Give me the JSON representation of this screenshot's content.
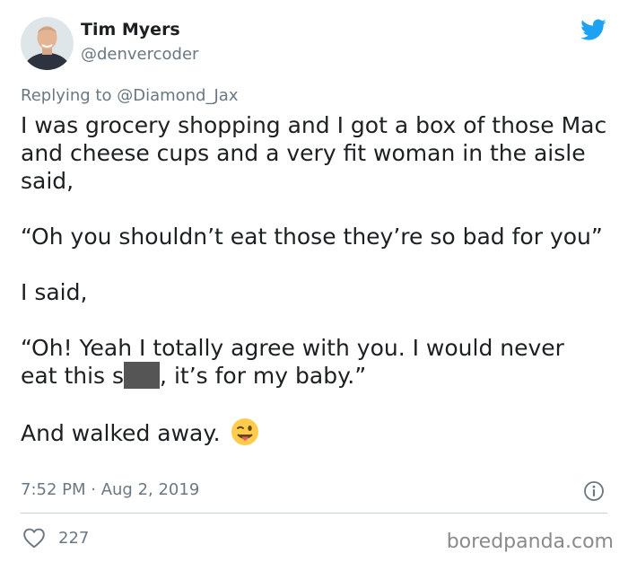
{
  "author": {
    "name": "Tim Myers",
    "handle": "@denvercoder"
  },
  "reply": {
    "prefix": "Replying to ",
    "target": "@Diamond_Jax"
  },
  "tweet": {
    "p1": "I was grocery shopping and I got a box of those Mac and cheese cups and a very fit woman in the aisle said,",
    "p2": " “Oh you shouldn’t eat those they’re so bad for you”",
    "p3": "I said,",
    "p4_line1": "“Oh! Yeah I totally agree with you. I would never",
    "p4_pre": "eat this s",
    "p4_post": ", it’s for my baby.”",
    "p5": "And walked away."
  },
  "meta": {
    "time": "7:52 PM",
    "separator": " · ",
    "date": "Aug 2, 2019"
  },
  "likes": {
    "count": "227"
  },
  "watermark": "boredpanda.com",
  "icons": {
    "brand": "twitter-bird-icon",
    "info": "info-icon",
    "like": "heart-icon",
    "emoji": "winking-face-with-tongue-emoji"
  },
  "colors": {
    "twitter_blue": "#1da1f2",
    "text": "#1c2022",
    "secondary": "#697882",
    "censor": "#555555"
  }
}
